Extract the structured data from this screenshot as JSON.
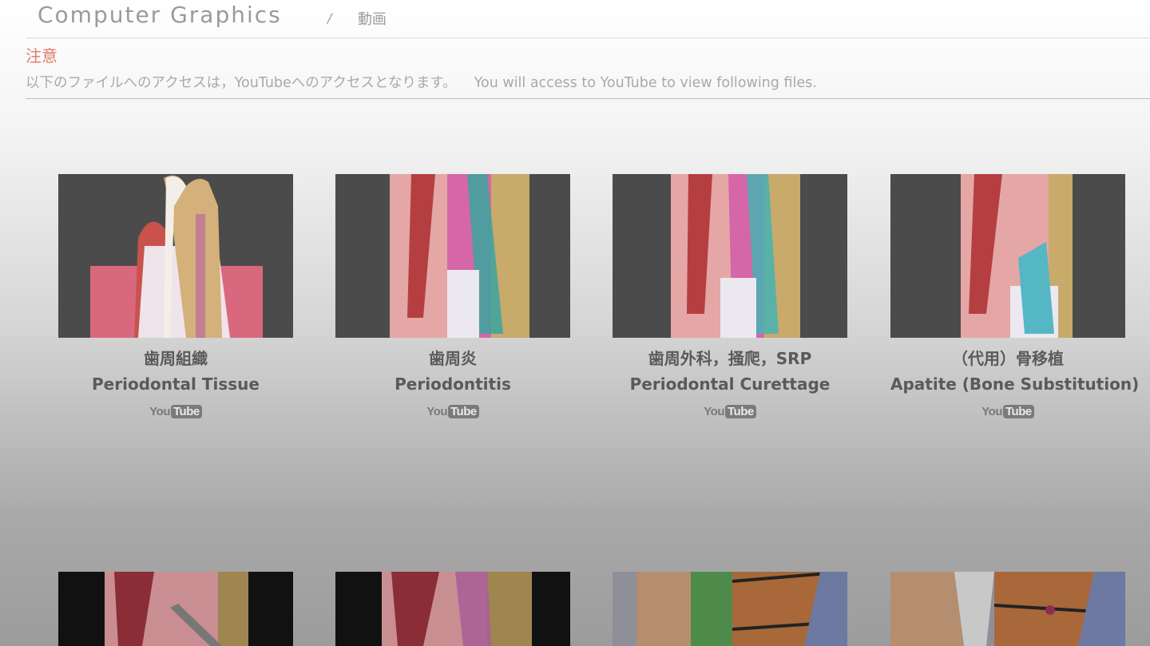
{
  "header": {
    "title": "Computer Graphics",
    "separator": "/",
    "subtitle": "動画"
  },
  "notice": {
    "title": "注意",
    "text_ja": "以下のファイルへのアクセスは，YouTubeへのアクセスとなります。",
    "text_en": "You will access to YouTube to view following files."
  },
  "videos": [
    {
      "title_ja": "歯周組織",
      "title_en": "Periodontal Tissue",
      "youtube": {
        "you": "You",
        "tube": "Tube"
      }
    },
    {
      "title_ja": "歯周炎",
      "title_en": "Periodontitis",
      "youtube": {
        "you": "You",
        "tube": "Tube"
      }
    },
    {
      "title_ja": "歯周外科，掻爬，SRP",
      "title_en": "Periodontal Curettage",
      "youtube": {
        "you": "You",
        "tube": "Tube"
      }
    },
    {
      "title_ja": "（代用）骨移植",
      "title_en": "Apatite (Bone Substitution)",
      "youtube": {
        "you": "You",
        "tube": "Tube"
      }
    }
  ],
  "icons": {
    "youtube_logo": "youtube-logo-icon"
  },
  "colors": {
    "notice_title": "#e07a68",
    "thumb_background": "#4a4a4a",
    "text": "#5a5a5a"
  }
}
